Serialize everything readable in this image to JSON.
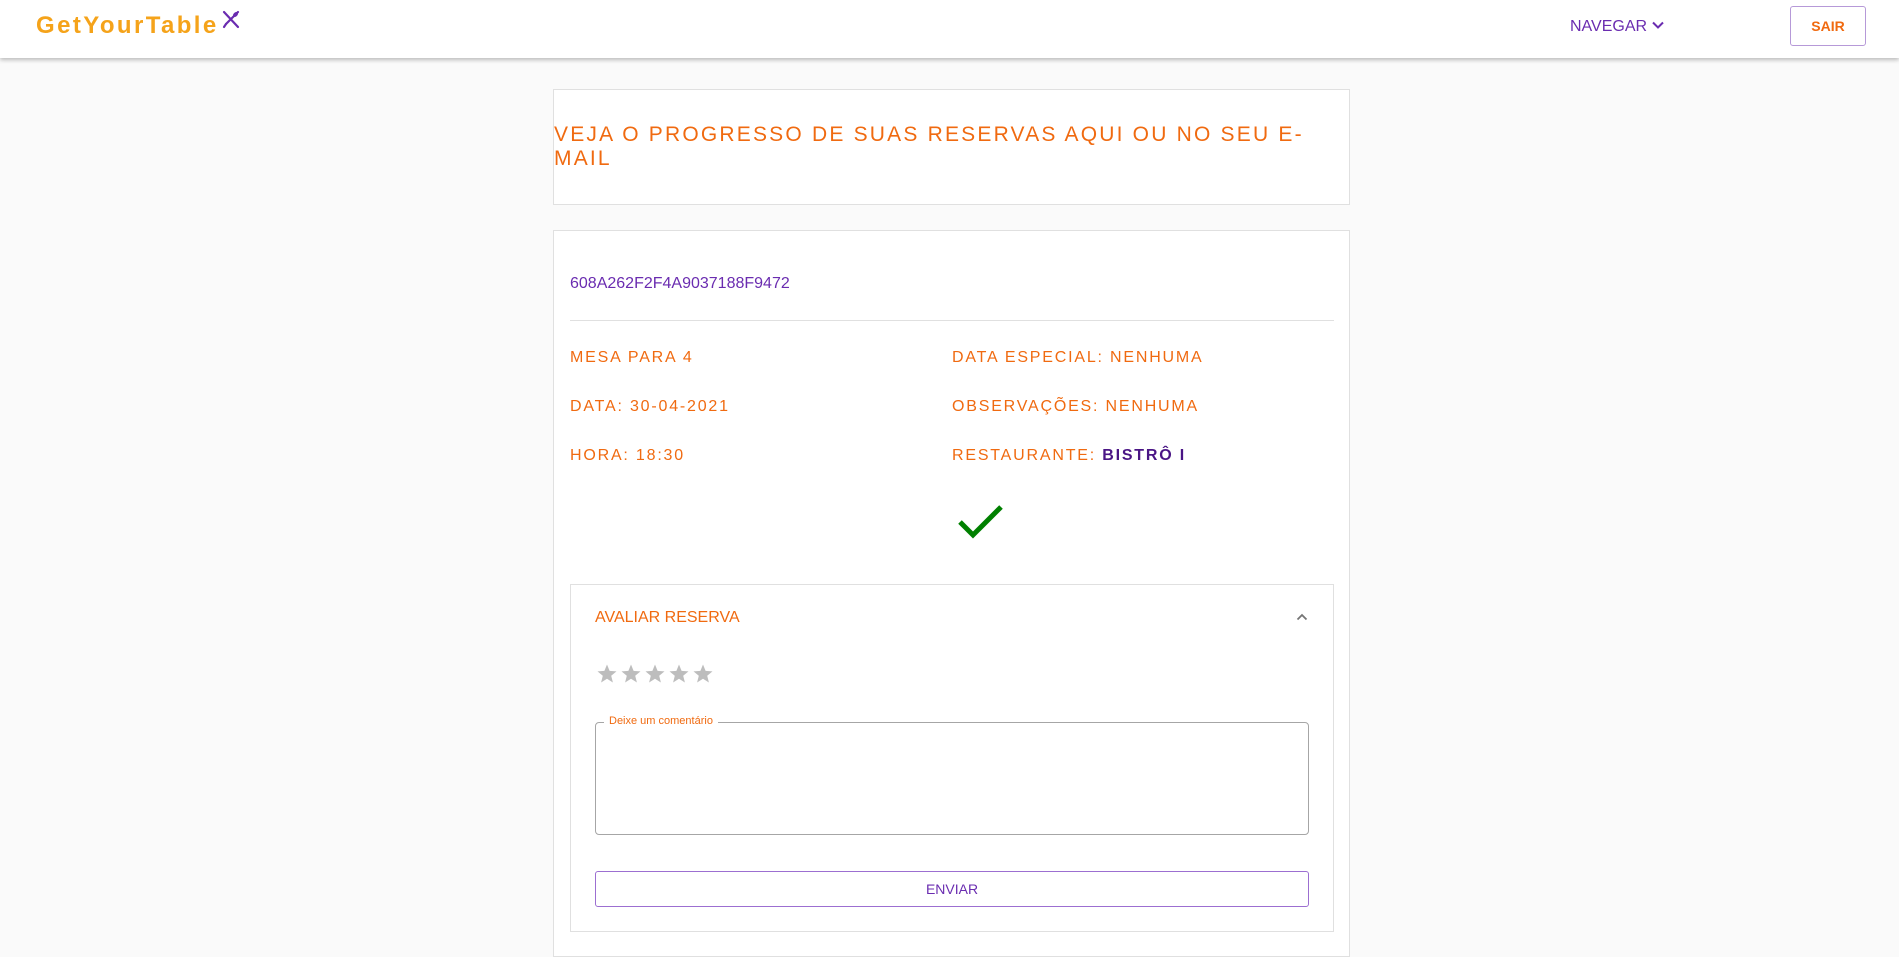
{
  "appbar": {
    "brand": "GetYourTable",
    "brand_icon": "utensils-icon",
    "nav_label": "NAVEGAR",
    "logout_label": "SAIR"
  },
  "header": {
    "headline": "VEJA O PROGRESSO DE SUAS RESERVAS AQUI OU NO SEU E-MAIL"
  },
  "reservation": {
    "id": "608A262F2F4A9037188F9472",
    "table": "MESA PARA 4",
    "date": "DATA: 30-04-2021",
    "time": "HORA: 18:30",
    "special_date": "DATA ESPECIAL: NENHUMA",
    "notes": "OBSERVAÇÕES: NENHUMA",
    "restaurant_label": "RESTAURANTE: ",
    "restaurant_name": "BISTRÔ I",
    "status_icon": "check-icon",
    "status_color": "#008000"
  },
  "review": {
    "title": "AVALIAR RESERVA",
    "rating": 0,
    "max_rating": 5,
    "comment_label": "Deixe um comentário",
    "comment_value": "",
    "submit_label": "ENVIAR"
  },
  "colors": {
    "brand": "#f5a31a",
    "accent_orange": "#f06a10",
    "accent_purple": "#6a2cb0",
    "dark_purple": "#4a1585",
    "background": "#fafafa"
  }
}
